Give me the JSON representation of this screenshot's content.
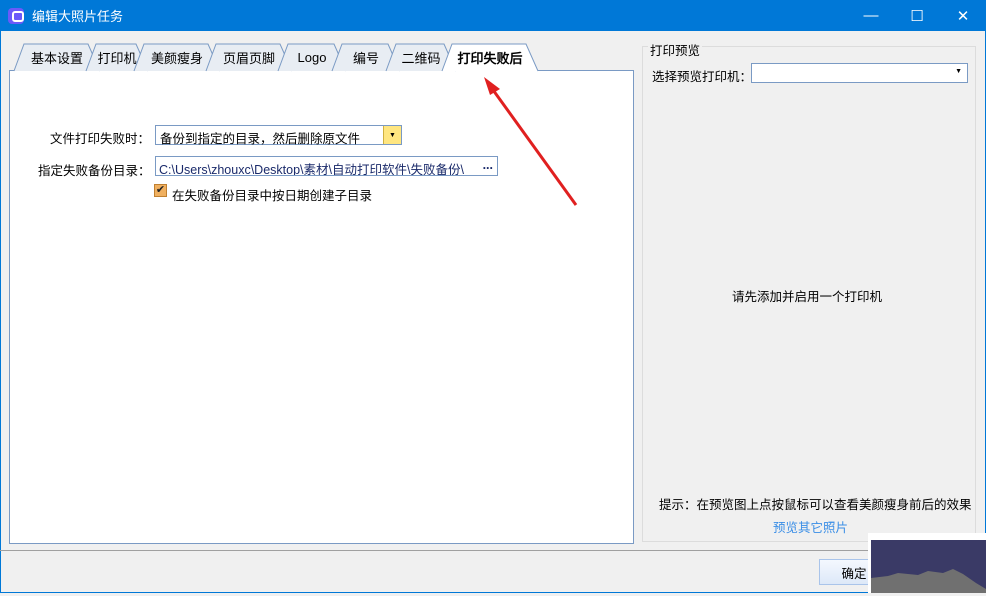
{
  "window": {
    "title": "编辑大照片任务",
    "minimize": "—",
    "maximize": "☐",
    "close": "✕"
  },
  "tabs": [
    {
      "label": "基本设置"
    },
    {
      "label": "打印机"
    },
    {
      "label": "美颜瘦身"
    },
    {
      "label": "页眉页脚"
    },
    {
      "label": "Logo"
    },
    {
      "label": "编号"
    },
    {
      "label": "二维码"
    },
    {
      "label": "打印失败后",
      "active": true
    }
  ],
  "form": {
    "on_fail_label": "文件打印失败时：",
    "on_fail_value": "备份到指定的目录，然后删除原文件",
    "backup_dir_label": "指定失败备份目录：",
    "backup_dir_value": "C:\\Users\\zhouxc\\Desktop\\素材\\自动打印软件\\失败备份\\",
    "browse": "...",
    "subdir_checkbox": "在失败备份目录中按日期创建子目录",
    "subdir_checked": true
  },
  "preview": {
    "group_title": "打印预览",
    "printer_label": "选择预览打印机：",
    "printer_value": "",
    "empty_message": "请先添加并启用一个打印机",
    "hint": "提示：在预览图上点按鼠标可以查看美颜瘦身前后的效果",
    "other_photos_link": "预览其它照片"
  },
  "footer": {
    "ok": "确定"
  },
  "colors": {
    "titlebar": "#0078d7",
    "annotation_arrow": "#e02020",
    "link": "#3a8ee6"
  }
}
